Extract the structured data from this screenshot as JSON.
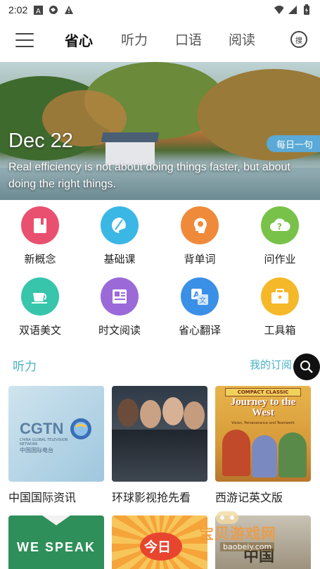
{
  "status_bar": {
    "time": "2:02"
  },
  "nav": {
    "tabs": [
      "省心",
      "听力",
      "口语",
      "阅读"
    ],
    "active_tab": "省心",
    "search_label": "搜"
  },
  "banner": {
    "date": "Dec 22",
    "quote": "Real efficiency is not about doing things faster, but about doing the right things.",
    "daily_tag": "每日一句"
  },
  "features": [
    {
      "label": "新概念",
      "color": "#e9506f",
      "icon": "book-icon"
    },
    {
      "label": "基础课",
      "color": "#3bb7e6",
      "icon": "palette-icon"
    },
    {
      "label": "背单词",
      "color": "#f08a3b",
      "icon": "head-icon"
    },
    {
      "label": "问作业",
      "color": "#79c24a",
      "icon": "question-cloud-icon"
    },
    {
      "label": "双语美文",
      "color": "#37c5ac",
      "icon": "coffee-icon"
    },
    {
      "label": "时文阅读",
      "color": "#9b6ad8",
      "icon": "newspaper-icon"
    },
    {
      "label": "省心翻译",
      "color": "#3a8fe6",
      "icon": "translate-icon"
    },
    {
      "label": "工具箱",
      "color": "#f5b829",
      "icon": "toolbox-icon"
    }
  ],
  "listening": {
    "title": "听力",
    "more": "我的订阅",
    "cards": [
      {
        "title": "中国国际资讯",
        "brand": "CGTN",
        "brand_sub1": "CHINA GLOBAL TELEVISION NETWORK",
        "brand_sub2": "中国国际电台"
      },
      {
        "title": "环球影视抢先看"
      },
      {
        "title": "西游记英文版",
        "badge": "COMPACT CLASSIC",
        "book_title": "Journey to the West",
        "book_sub": "Vision, Perseverance and Teamwork"
      }
    ],
    "bottom_cards": [
      {
        "text": "WE SPEAK"
      },
      {
        "text": "今日"
      },
      {
        "text": "中国"
      }
    ]
  },
  "watermark": {
    "cn": "宝贝游戏网",
    "url": "baobeiy.com"
  },
  "colors": {
    "accent": "#47b3c4",
    "tag": "#5aa9d6"
  }
}
